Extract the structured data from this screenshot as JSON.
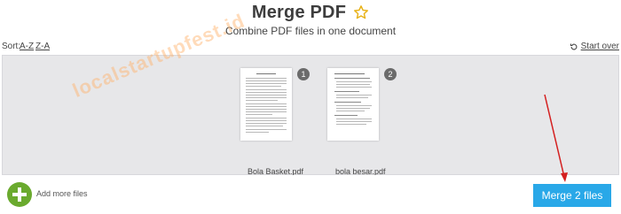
{
  "header": {
    "title": "Merge PDF",
    "subtitle": "Combine PDF files in one document",
    "favorite_icon": "star-outline-icon"
  },
  "sort": {
    "label": "Sort:",
    "az": "A-Z",
    "za": "Z-A",
    "start_over": "Start over",
    "start_over_icon": "restart-icon"
  },
  "files": [
    {
      "index": "1",
      "name": "Bola Basket.pdf"
    },
    {
      "index": "2",
      "name": "bola besar.pdf"
    }
  ],
  "footer": {
    "add_label": "Add more files",
    "add_icon": "plus-icon",
    "merge_label": "Merge 2 files"
  },
  "watermark": "localstartupfest.id",
  "colors": {
    "accent_blue": "#29a8e8",
    "add_green": "#6aaa2e",
    "badge_gray": "#6b6b6b",
    "star_gold": "#e8b31c",
    "annotation_red": "#d42020"
  }
}
